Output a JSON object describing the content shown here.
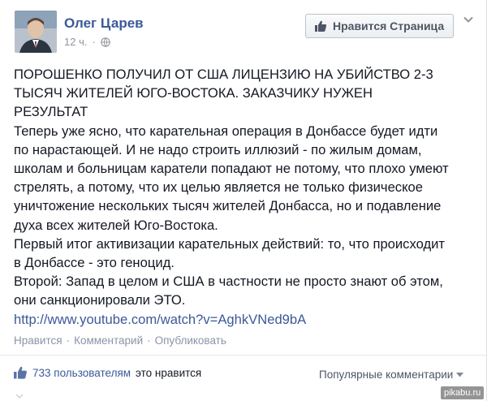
{
  "header": {
    "author_name": "Олег Царев",
    "timestamp": "12 ч.",
    "like_page_label": "Нравится Страница"
  },
  "post": {
    "headline_lines": [
      "ПОРОШЕНКО ПОЛУЧИЛ ОТ США ЛИЦЕНЗИЮ НА УБИЙСТВО 2-3",
      "ТЫСЯЧ ЖИТЕЛЕЙ ЮГО-ВОСТОКА. ЗАКАЗЧИКУ НУЖЕН",
      "РЕЗУЛЬТАТ"
    ],
    "body_lines": [
      "Теперь уже ясно, что карательная операция в Донбассе будет идти",
      "по нарастающей. И не надо строить иллюзий - по жилым домам,",
      "школам и больницам каратели попадают не потому, что плохо умеют",
      "стрелять, а потому, что их целью является не только физическое",
      "уничтожение нескольких тысяч жителей Донбасса, но и подавление",
      "духа всех жителей Юго-Востока.",
      "Первый итог активизации карательных действий: то, что происходит",
      "в Донбассе - это геноцид.",
      "Второй: Запад в целом и США в частности не просто знают об этом,",
      "они санкционировали ЭТО."
    ],
    "link": "http://www.youtube.com/watch?v=AghkVNed9bA"
  },
  "actions": {
    "like": "Нравится",
    "comment": "Комментарий",
    "share": "Опубликовать",
    "separator": "·"
  },
  "footer": {
    "likes_count_text": "733 пользователям",
    "likes_suffix": "это нравится",
    "sort_label": "Популярные комментарии"
  },
  "watermark": "pikabu.ru",
  "colors": {
    "link_blue": "#3b5998",
    "muted_gray": "#90949c",
    "text": "#141823"
  },
  "icons": [
    "globe-icon",
    "thumbs-up-icon",
    "chevron-down-icon",
    "like-icon",
    "caret-down-icon"
  ]
}
